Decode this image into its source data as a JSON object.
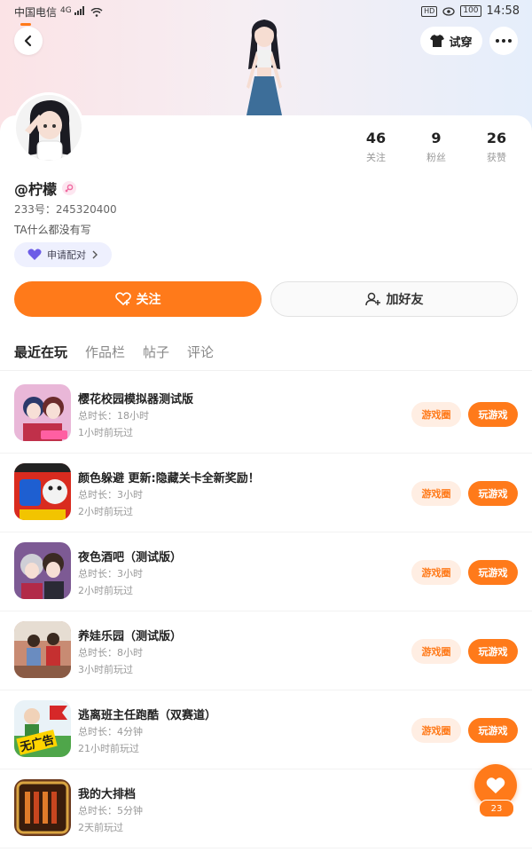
{
  "status_bar": {
    "carrier": "中国电信",
    "signal": "4G",
    "hd": "HD",
    "battery": "100",
    "time": "14:58"
  },
  "header": {
    "tryon_label": "试穿"
  },
  "profile": {
    "username": "@柠檬",
    "uid": "233号：245320400",
    "bio": "TA什么都没有写",
    "pair_label": "申请配对",
    "stats": [
      {
        "value": "46",
        "label": "关注"
      },
      {
        "value": "9",
        "label": "粉丝"
      },
      {
        "value": "26",
        "label": "获赞"
      }
    ]
  },
  "actions": {
    "follow": "关注",
    "add_friend": "加好友"
  },
  "tabs": [
    {
      "label": "最近在玩",
      "active": true
    },
    {
      "label": "作品栏",
      "active": false
    },
    {
      "label": "帖子",
      "active": false
    },
    {
      "label": "评论",
      "active": false
    }
  ],
  "games": [
    {
      "title": "樱花校园模拟器测试版",
      "duration": "总时长：18小时",
      "last_played": "1小时前玩过",
      "circle": "游戏圈",
      "play": "玩游戏",
      "icon_color": "#e9b7d8",
      "icon_name": "sakura-school-icon"
    },
    {
      "title": "颜色躲避 更新:隐藏关卡全新奖励！",
      "duration": "总时长：3小时",
      "last_played": "2小时前玩过",
      "circle": "游戏圈",
      "play": "玩游戏",
      "icon_color": "#d92b1f",
      "icon_name": "color-dodge-icon"
    },
    {
      "title": "夜色酒吧（测试版）",
      "duration": "总时长：3小时",
      "last_played": "2小时前玩过",
      "circle": "游戏圈",
      "play": "玩游戏",
      "icon_color": "#7d5a94",
      "icon_name": "night-bar-icon"
    },
    {
      "title": "养娃乐园（测试版）",
      "duration": "总时长：8小时",
      "last_played": "3小时前玩过",
      "circle": "游戏圈",
      "play": "玩游戏",
      "icon_color": "#c88b73",
      "icon_name": "baby-park-icon"
    },
    {
      "title": "逃离班主任跑酷（双赛道）",
      "duration": "总时长：4分钟",
      "last_played": "21小时前玩过",
      "circle": "游戏圈",
      "play": "玩游戏",
      "icon_color": "#4fa64a",
      "icon_name": "escape-teacher-icon",
      "badge": "无广告"
    },
    {
      "title": "我的大排档",
      "duration": "总时长：5分钟",
      "last_played": "2天前玩过",
      "circle": "",
      "play": "",
      "icon_color": "#6b3a1f",
      "icon_name": "food-stall-icon"
    }
  ],
  "like": {
    "count": "23"
  },
  "colors": {
    "accent": "#ff7a1a",
    "accent_light": "#ffeee3",
    "pair_bg": "#eef0fe"
  }
}
